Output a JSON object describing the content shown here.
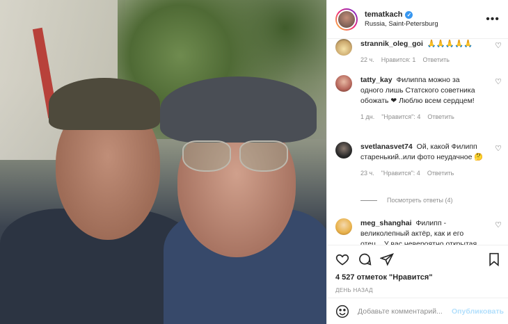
{
  "post": {
    "image_alt": ""
  },
  "header": {
    "username": "tematkach",
    "location": "Russia, Saint-Petersburg",
    "more_icon": "more-horizontal-icon"
  },
  "comments": [
    {
      "username": "strannik_oleg_goi",
      "text": "🙏🙏🙏🙏🙏",
      "time": "22 ч.",
      "likes": "Нравится: 1",
      "reply": "Ответить",
      "avatar_color": "#c9a66b"
    },
    {
      "username": "tatty_kay",
      "text": "Филиппа можно за одного лишь Статского советника обожать ❤ Люблю всем сердцем!",
      "time": "1 дн.",
      "likes": "\"Нравится\": 4",
      "reply": "Ответить",
      "avatar_color": "#b5655a"
    },
    {
      "username": "svetlanasvet74",
      "text": "Ой, какой Филипп старенький..или фото неудачное 🤔",
      "time": "23 ч.",
      "likes": "\"Нравится\": 4",
      "reply": "Ответить",
      "avatar_color": "#2b2b2b"
    },
    {
      "username": "meg_shanghai",
      "text": "Филипп - великолепный актёр, как и его отец... У вас невероятно открытая",
      "time": "",
      "likes": "",
      "reply": "",
      "avatar_color": "#e8b14a"
    }
  ],
  "view_replies": "Посмотреть ответы (4)",
  "likes_count": "4 527 отметок \"Нравится\"",
  "post_date": "ДЕНЬ НАЗАД",
  "add_comment": {
    "placeholder": "Добавьте комментарий...",
    "post_label": "Опубликовать"
  },
  "colors": {
    "accent": "#3897f0",
    "post_disabled": "#b2dffc",
    "muted": "#8e8e8e",
    "text": "#262626"
  },
  "icons": [
    "heart-icon",
    "comment-icon",
    "share-icon",
    "bookmark-icon",
    "emoji-icon",
    "verified-icon"
  ]
}
